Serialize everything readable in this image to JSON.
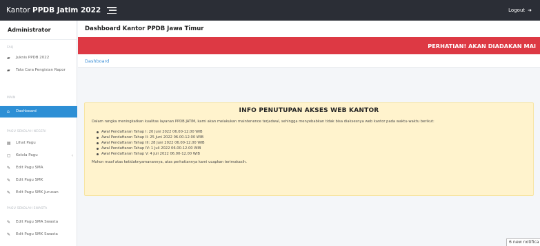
{
  "navbar": {
    "brand_prefix": "Kantor",
    "brand_bold": "PPDB Jatim 2022",
    "logout_label": "Logout",
    "logout_icon": "sign-out-icon"
  },
  "sidebar": {
    "user": "Administrator",
    "sections": [
      {
        "heading": "FAQ"
      },
      {
        "heading": "MAIN"
      },
      {
        "heading": "PAGU SEKOLAH NEGERI"
      },
      {
        "heading": "PAGU SEKOLAH SWASTA"
      }
    ],
    "items": [
      {
        "label": "Juknis PPDB 2022",
        "icon": "book-icon"
      },
      {
        "label": "Tata Cara Pengisian Rapor",
        "icon": "book-icon"
      },
      {
        "label": "Dashboard",
        "icon": "home-icon",
        "active": true
      },
      {
        "label": "Lihat Pagu",
        "icon": "table-icon"
      },
      {
        "label": "Kelola Pagu",
        "icon": "calendar-icon",
        "chevron": "‹"
      },
      {
        "label": "Edit Pagu SMA",
        "icon": "pencil-icon"
      },
      {
        "label": "Edit Pagu SMK",
        "icon": "pencil-icon"
      },
      {
        "label": "Edit Pagu SMK Jurusan",
        "icon": "pencil-icon"
      },
      {
        "label": "Edit Pagu SMA Swasta",
        "icon": "pencil-icon"
      },
      {
        "label": "Edit Pagu SMK Swasta",
        "icon": "pencil-icon"
      }
    ]
  },
  "main": {
    "page_title": "Dashboard Kantor PPDB Jawa Timur",
    "alert_text": "PERHATIAN!  AKAN DIADAKAN MAI",
    "breadcrumb": "Dashboard",
    "info": {
      "title": "INFO PENUTUPAN AKSES WEB KANTOR",
      "intro": "Dalam rangka meningkatkan kualitas layanan PPDB JATIM, kami akan melakukan maintenence terjadwal, sehingga menyebabkan tidak bisa diaksesnya web kantor pada waktu-waktu berikut:",
      "schedule": [
        "Awal Pendaftaran Tahap I: 20 Juni 2022 06.00-12.00 WIB",
        "Awal Pendaftaran Tahap II: 25 Juni 2022 06.00-12.00 WIB",
        "Awal Pendaftaran Tahap III: 28 Juni 2022 06.00-12.00 WIB",
        "Awal Pendaftaran Tahap IV: 1 Juli 2022 06.00-12.00 WIB",
        "Awal Pendaftaran Tahap V: 4 Juli 2022 06.00-12.00 WIB"
      ],
      "closing": "Mohon maaf atas ketidaknyamanannya, atas perhatiannya kami ucapkan terimakasih."
    }
  },
  "toast": {
    "text": "6 new notifica"
  },
  "colors": {
    "navbar": "#2b2e36",
    "active_item": "#2d8fd5",
    "alert": "#dd3944",
    "info_bg": "#fff3cd",
    "link": "#3d8fd6"
  }
}
